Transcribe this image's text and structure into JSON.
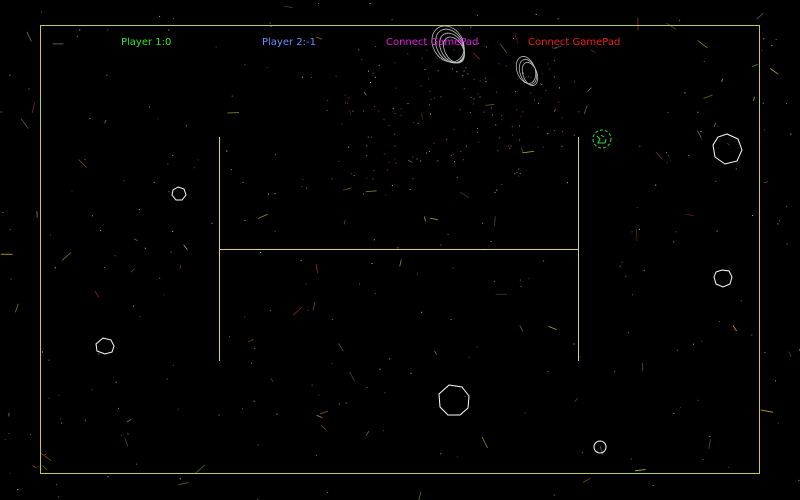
{
  "hud": {
    "players": [
      {
        "label": "Player 1:0",
        "color": "#2ee62e"
      },
      {
        "label": "Player 2:-1",
        "color": "#6f8dff"
      },
      {
        "label": "Connect GamePad",
        "color": "#e21ee2"
      },
      {
        "label": "Connect GamePad",
        "color": "#f01e1e"
      }
    ]
  },
  "colors": {
    "background": "#000000",
    "arena_border": "#c8c84a",
    "walls": "#d8d07a",
    "asteroids": "#ffffff",
    "ship": "#33dd33"
  },
  "icons": {
    "asteroid": "asteroid-icon",
    "ship": "player-ship-icon",
    "bullet": "bullet-icon"
  }
}
